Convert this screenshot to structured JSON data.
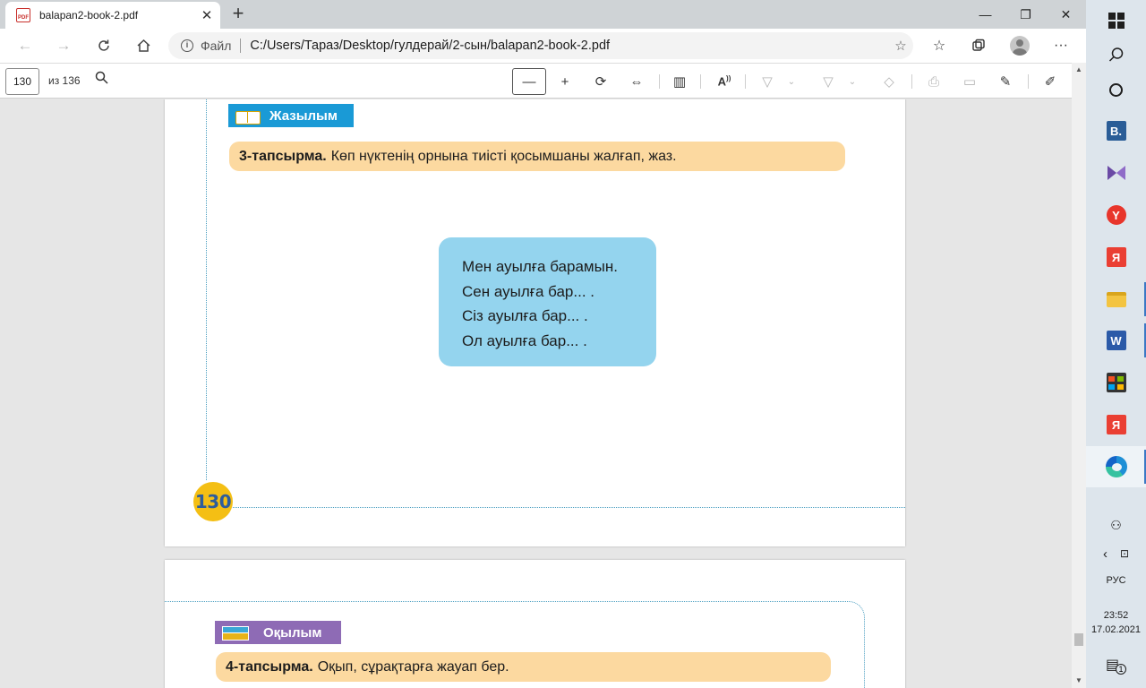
{
  "browser": {
    "tab": {
      "title": "balapan2-book-2.pdf",
      "icon": "pdf-file-icon",
      "icon_label": "PDF"
    },
    "window_controls": {
      "minimize": "—",
      "restore": "❐",
      "close": "✕"
    },
    "address": {
      "scheme_label": "Файл",
      "url": "C:/Users/Тараз/Desktop/гулдерай/2-сын/balapan2-book-2.pdf"
    }
  },
  "pdf_toolbar": {
    "current_page": "130",
    "total_pages": "из 136"
  },
  "page1": {
    "section_title": "Жазылым",
    "section_color": "#1a9ad6",
    "task_label": "3-тапсырма.",
    "task_text": "Көп нүктенің орнына тиісті қосымшаны жалғап, жаз.",
    "bubble_lines": [
      "Мен ауылға барамын.",
      "Сен ауылға бар... .",
      "Сіз ауылға бар... .",
      "Ол ауылға бар... ."
    ],
    "page_number": "130"
  },
  "page2": {
    "section_title": "Оқылым",
    "section_color": "#8e6bb5",
    "task_label": "4-тапсырма.",
    "task_text": "Оқып, сұрақтарға жауап бер."
  },
  "taskbar": {
    "language": "РУС",
    "time": "23:52",
    "date": "17.02.2021",
    "notification_count": "1"
  },
  "colors": {
    "task_bg": "#fcd9a0",
    "bubble_bg": "#94d4ee",
    "page_badge": "#f4bf14"
  }
}
